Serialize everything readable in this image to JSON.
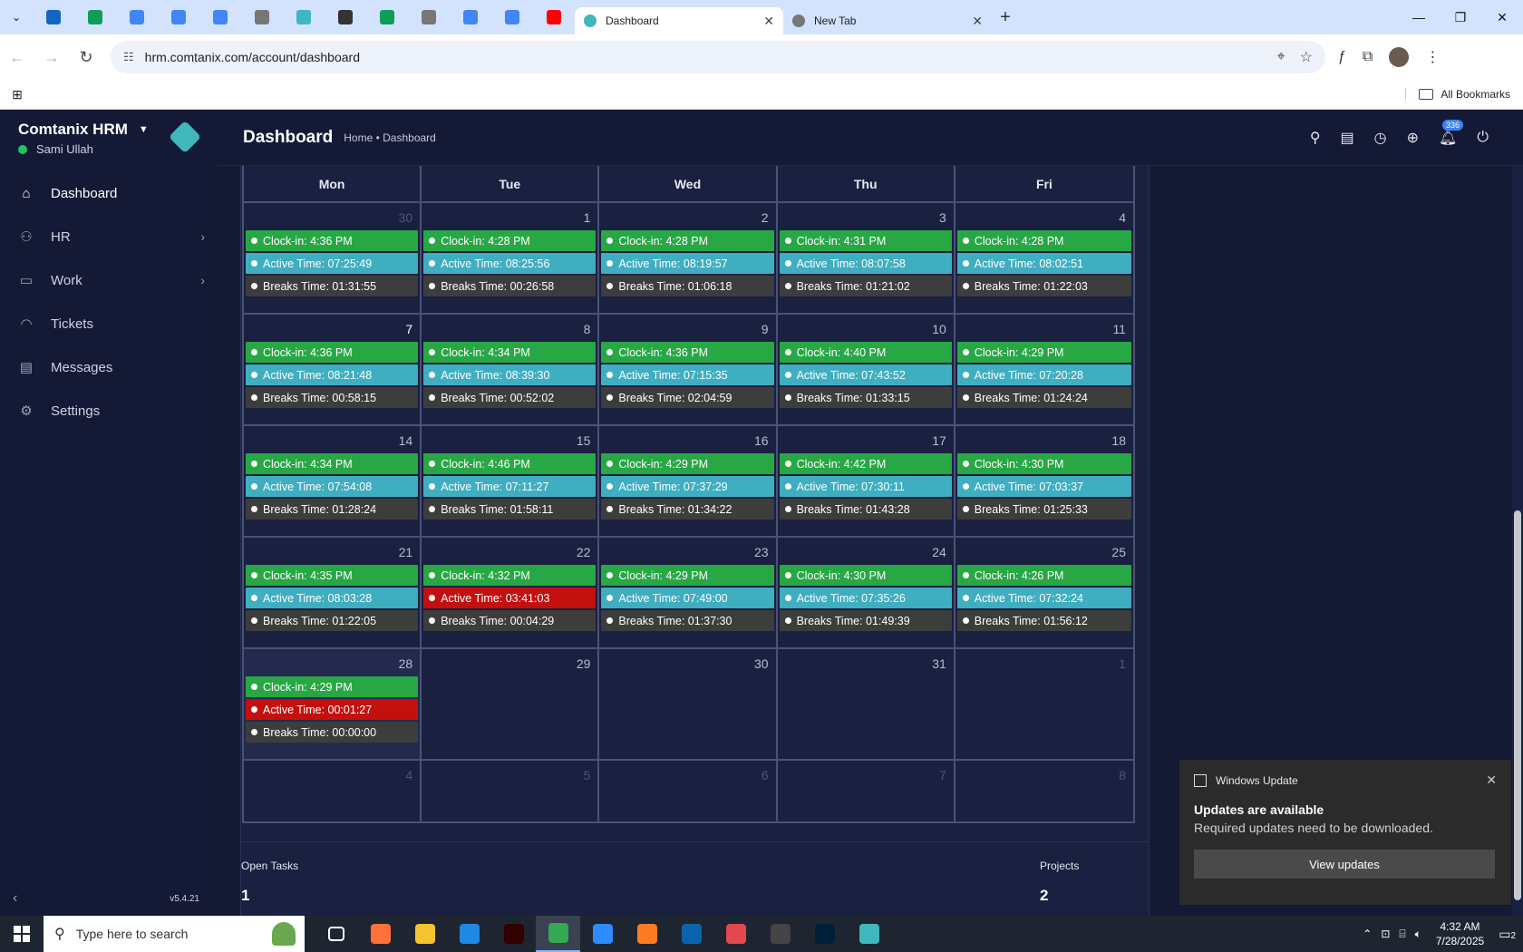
{
  "browser": {
    "tabs": [
      {
        "title": "Dashboard",
        "active": true
      },
      {
        "title": "New Tab",
        "active": false
      }
    ],
    "url": "hrm.comtanix.com/account/dashboard",
    "bookmarks_label": "All Bookmarks",
    "pinned_tab_colors": [
      "#1565c0",
      "#0f9d58",
      "#4285f4",
      "#4285f4",
      "#4285f4",
      "#777777",
      "#3fb7bd",
      "#333333",
      "#0f9d58",
      "#777777",
      "#4285f4",
      "#4285f4",
      "#ff0000"
    ]
  },
  "sidebar": {
    "brand": "Comtanix HRM",
    "user": "Sami Ullah",
    "items": [
      {
        "label": "Dashboard",
        "icon": "home-icon",
        "glyph": "⌂",
        "active": true,
        "arrow": false
      },
      {
        "label": "HR",
        "icon": "people-icon",
        "glyph": "⚇",
        "active": false,
        "arrow": true
      },
      {
        "label": "Work",
        "icon": "briefcase-icon",
        "glyph": "▭",
        "active": false,
        "arrow": true
      },
      {
        "label": "Tickets",
        "icon": "headset-icon",
        "glyph": "◠",
        "active": false,
        "arrow": false
      },
      {
        "label": "Messages",
        "icon": "message-icon",
        "glyph": "▤",
        "active": false,
        "arrow": false
      },
      {
        "label": "Settings",
        "icon": "gear-icon",
        "glyph": "⚙",
        "active": false,
        "arrow": false
      }
    ],
    "version": "v5.4.21"
  },
  "header": {
    "title": "Dashboard",
    "breadcrumb": "Home • Dashboard",
    "notification_count": "336"
  },
  "calendar": {
    "days": [
      "Mon",
      "Tue",
      "Wed",
      "Thu",
      "Fri"
    ],
    "weeks": [
      [
        {
          "day": "30",
          "muted": true,
          "events": [
            {
              "type": "green",
              "text": "Clock-in: 4:36 PM"
            },
            {
              "type": "teal",
              "text": "Active Time: 07:25:49"
            },
            {
              "type": "dark",
              "text": "Breaks Time: 01:31:55"
            }
          ]
        },
        {
          "day": "1",
          "events": [
            {
              "type": "green",
              "text": "Clock-in: 4:28 PM"
            },
            {
              "type": "teal",
              "text": "Active Time: 08:25:56"
            },
            {
              "type": "dark",
              "text": "Breaks Time: 00:26:58"
            }
          ]
        },
        {
          "day": "2",
          "events": [
            {
              "type": "green",
              "text": "Clock-in: 4:28 PM"
            },
            {
              "type": "teal",
              "text": "Active Time: 08:19:57"
            },
            {
              "type": "dark",
              "text": "Breaks Time: 01:06:18"
            }
          ]
        },
        {
          "day": "3",
          "events": [
            {
              "type": "green",
              "text": "Clock-in: 4:31 PM"
            },
            {
              "type": "teal",
              "text": "Active Time: 08:07:58"
            },
            {
              "type": "dark",
              "text": "Breaks Time: 01:21:02"
            }
          ]
        },
        {
          "day": "4",
          "events": [
            {
              "type": "green",
              "text": "Clock-in: 4:28 PM"
            },
            {
              "type": "teal",
              "text": "Active Time: 08:02:51"
            },
            {
              "type": "dark",
              "text": "Breaks Time: 01:22:03"
            }
          ]
        }
      ],
      [
        {
          "day": "7",
          "bright": true,
          "events": [
            {
              "type": "green",
              "text": "Clock-in: 4:36 PM"
            },
            {
              "type": "teal",
              "text": "Active Time: 08:21:48"
            },
            {
              "type": "dark",
              "text": "Breaks Time: 00:58:15"
            }
          ]
        },
        {
          "day": "8",
          "events": [
            {
              "type": "green",
              "text": "Clock-in: 4:34 PM"
            },
            {
              "type": "teal",
              "text": "Active Time: 08:39:30"
            },
            {
              "type": "dark",
              "text": "Breaks Time: 00:52:02"
            }
          ]
        },
        {
          "day": "9",
          "events": [
            {
              "type": "green",
              "text": "Clock-in: 4:36 PM"
            },
            {
              "type": "teal",
              "text": "Active Time: 07:15:35"
            },
            {
              "type": "dark",
              "text": "Breaks Time: 02:04:59"
            }
          ]
        },
        {
          "day": "10",
          "events": [
            {
              "type": "green",
              "text": "Clock-in: 4:40 PM"
            },
            {
              "type": "teal",
              "text": "Active Time: 07:43:52"
            },
            {
              "type": "dark",
              "text": "Breaks Time: 01:33:15"
            }
          ]
        },
        {
          "day": "11",
          "events": [
            {
              "type": "green",
              "text": "Clock-in: 4:29 PM"
            },
            {
              "type": "teal",
              "text": "Active Time: 07:20:28"
            },
            {
              "type": "dark",
              "text": "Breaks Time: 01:24:24"
            }
          ]
        }
      ],
      [
        {
          "day": "14",
          "events": [
            {
              "type": "green",
              "text": "Clock-in: 4:34 PM"
            },
            {
              "type": "teal",
              "text": "Active Time: 07:54:08"
            },
            {
              "type": "dark",
              "text": "Breaks Time: 01:28:24"
            }
          ]
        },
        {
          "day": "15",
          "events": [
            {
              "type": "green",
              "text": "Clock-in: 4:46 PM"
            },
            {
              "type": "teal",
              "text": "Active Time: 07:11:27"
            },
            {
              "type": "dark",
              "text": "Breaks Time: 01:58:11"
            }
          ]
        },
        {
          "day": "16",
          "events": [
            {
              "type": "green",
              "text": "Clock-in: 4:29 PM"
            },
            {
              "type": "teal",
              "text": "Active Time: 07:37:29"
            },
            {
              "type": "dark",
              "text": "Breaks Time: 01:34:22"
            }
          ]
        },
        {
          "day": "17",
          "events": [
            {
              "type": "green",
              "text": "Clock-in: 4:42 PM"
            },
            {
              "type": "teal",
              "text": "Active Time: 07:30:11"
            },
            {
              "type": "dark",
              "text": "Breaks Time: 01:43:28"
            }
          ]
        },
        {
          "day": "18",
          "events": [
            {
              "type": "green",
              "text": "Clock-in: 4:30 PM"
            },
            {
              "type": "teal",
              "text": "Active Time: 07:03:37"
            },
            {
              "type": "dark",
              "text": "Breaks Time: 01:25:33"
            }
          ]
        }
      ],
      [
        {
          "day": "21",
          "events": [
            {
              "type": "green",
              "text": "Clock-in: 4:35 PM"
            },
            {
              "type": "teal",
              "text": "Active Time: 08:03:28"
            },
            {
              "type": "dark",
              "text": "Breaks Time: 01:22:05"
            }
          ]
        },
        {
          "day": "22",
          "events": [
            {
              "type": "green",
              "text": "Clock-in: 4:32 PM"
            },
            {
              "type": "red",
              "text": "Active Time: 03:41:03"
            },
            {
              "type": "dark",
              "text": "Breaks Time: 00:04:29"
            }
          ]
        },
        {
          "day": "23",
          "events": [
            {
              "type": "green",
              "text": "Clock-in: 4:29 PM"
            },
            {
              "type": "teal",
              "text": "Active Time: 07:49:00"
            },
            {
              "type": "dark",
              "text": "Breaks Time: 01:37:30"
            }
          ]
        },
        {
          "day": "24",
          "events": [
            {
              "type": "green",
              "text": "Clock-in: 4:30 PM"
            },
            {
              "type": "teal",
              "text": "Active Time: 07:35:26"
            },
            {
              "type": "dark",
              "text": "Breaks Time: 01:49:39"
            }
          ]
        },
        {
          "day": "25",
          "events": [
            {
              "type": "green",
              "text": "Clock-in: 4:26 PM"
            },
            {
              "type": "teal",
              "text": "Active Time: 07:32:24"
            },
            {
              "type": "dark",
              "text": "Breaks Time: 01:56:12"
            }
          ]
        }
      ],
      [
        {
          "day": "28",
          "today": true,
          "events": [
            {
              "type": "green",
              "text": "Clock-in: 4:29 PM"
            },
            {
              "type": "red",
              "text": "Active Time: 00:01:27"
            },
            {
              "type": "dark",
              "text": "Breaks Time: 00:00:00"
            }
          ]
        },
        {
          "day": "29",
          "events": []
        },
        {
          "day": "30",
          "events": []
        },
        {
          "day": "31",
          "events": []
        },
        {
          "day": "1",
          "muted": true,
          "events": []
        }
      ],
      [
        {
          "day": "4",
          "muted": true,
          "events": []
        },
        {
          "day": "5",
          "muted": true,
          "events": []
        },
        {
          "day": "6",
          "muted": true,
          "events": []
        },
        {
          "day": "7",
          "muted": true,
          "events": []
        },
        {
          "day": "8",
          "muted": true,
          "events": []
        }
      ]
    ]
  },
  "stats": {
    "open_tasks_label": "Open Tasks",
    "open_tasks_value": "1",
    "projects_label": "Projects",
    "projects_value": "2"
  },
  "toast": {
    "app": "Windows Update",
    "title": "Updates are available",
    "message": "Required updates need to be downloaded.",
    "button": "View updates"
  },
  "taskbar": {
    "search_placeholder": "Type here to search",
    "time": "4:32 AM",
    "date": "7/28/2025",
    "notification_count": "2",
    "apps": [
      {
        "name": "task-view-icon",
        "color": "#1f2530"
      },
      {
        "name": "firefox-icon",
        "color": "#ff7139"
      },
      {
        "name": "file-explorer-icon",
        "color": "#f4c430"
      },
      {
        "name": "vscode-icon",
        "color": "#1e88e5"
      },
      {
        "name": "illustrator-icon",
        "color": "#330000"
      },
      {
        "name": "chrome-icon",
        "color": "#34a853",
        "active": true
      },
      {
        "name": "zoom-icon",
        "color": "#2d8cff"
      },
      {
        "name": "xampp-icon",
        "color": "#fb7a24"
      },
      {
        "name": "outlook-icon",
        "color": "#0a64ad"
      },
      {
        "name": "creative-cloud-icon",
        "color": "#e34850"
      },
      {
        "name": "pen-tool-icon",
        "color": "#444444"
      },
      {
        "name": "photoshop-icon",
        "color": "#001e36"
      },
      {
        "name": "comtanix-app-icon",
        "color": "#3fb7bd"
      }
    ]
  }
}
